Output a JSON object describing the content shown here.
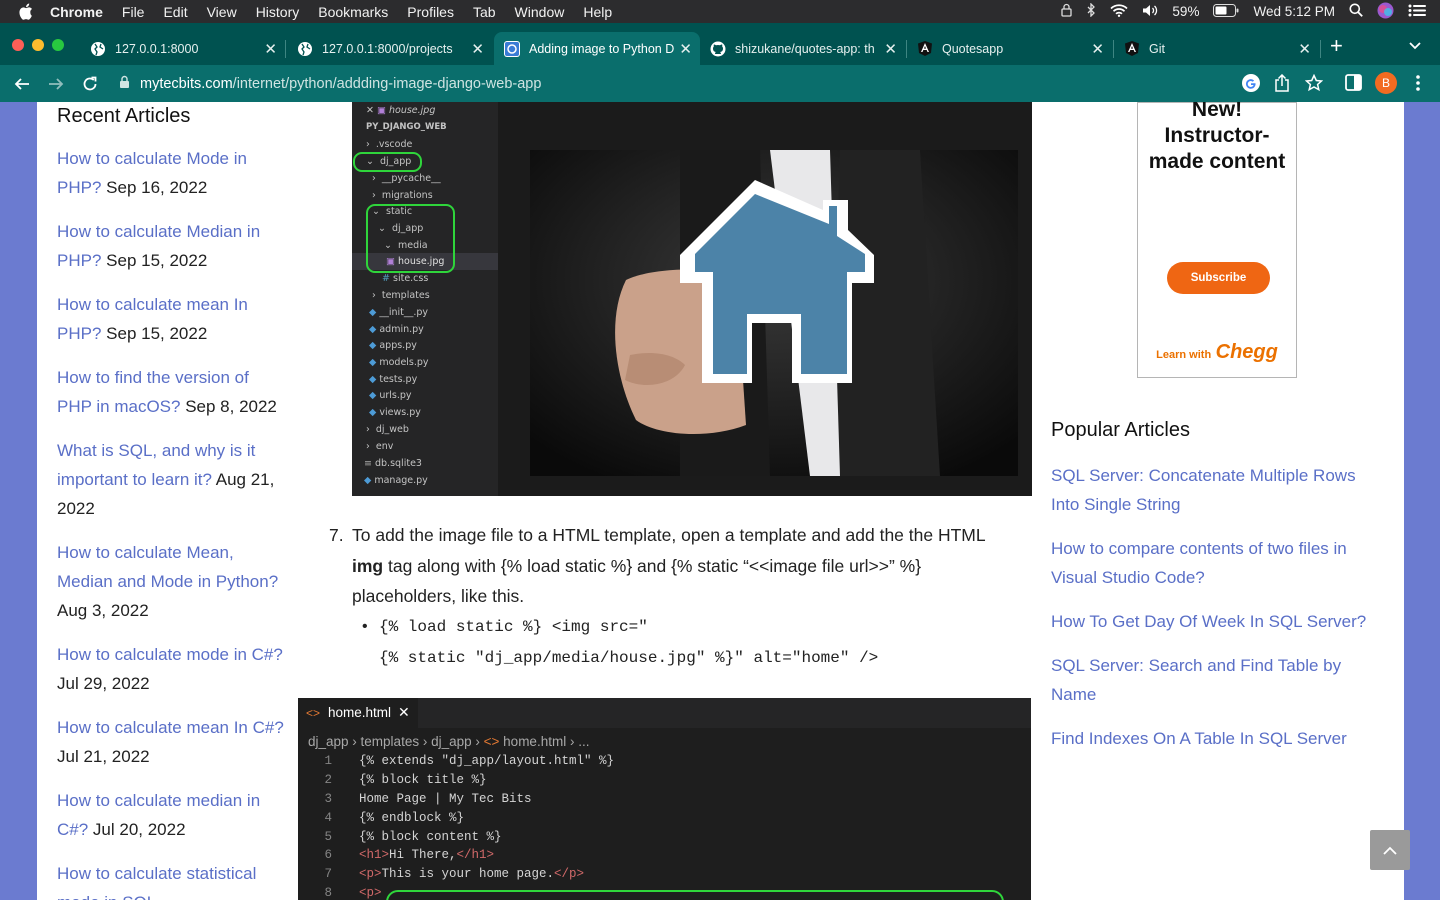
{
  "menubar": {
    "app": "Chrome",
    "items": [
      "File",
      "Edit",
      "View",
      "History",
      "Bookmarks",
      "Profiles",
      "Tab",
      "Window",
      "Help"
    ],
    "battery": "59%",
    "clock": "Wed 5:12 PM"
  },
  "tabs": [
    {
      "title": "127.0.0.1:8000"
    },
    {
      "title": "127.0.0.1:8000/projects"
    },
    {
      "title": "Adding image to Python D"
    },
    {
      "title": "shizukane/quotes-app: th"
    },
    {
      "title": "Quotesapp"
    },
    {
      "title": "Git"
    }
  ],
  "address": {
    "domain": "mytecbits.com",
    "path": "/internet/python/addding-image-django-web-app"
  },
  "profile_initial": "B",
  "recent": {
    "title": "Recent Articles",
    "items": [
      {
        "link": "How to calculate Mode in PHP?",
        "date": " Sep 16, 2022"
      },
      {
        "link": "How to calculate Median in PHP?",
        "date": " Sep 15, 2022"
      },
      {
        "link": "How to calculate mean In PHP?",
        "date": " Sep 15, 2022"
      },
      {
        "link": "How to find the version of PHP in macOS?",
        "date": " Sep 8, 2022"
      },
      {
        "link": "What is SQL, and why is it important to learn it?",
        "date": " Aug 21, 2022"
      },
      {
        "link": "How to calculate Mean, Median and Mode in Python?",
        "date": " Aug 3, 2022"
      },
      {
        "link": "How to calculate mode in C#?",
        "date": " Jul 29, 2022"
      },
      {
        "link": "How to calculate mean In C#?",
        "date": " Jul 21, 2022"
      },
      {
        "link": "How to calculate median in C#?",
        "date": " Jul 20, 2022"
      },
      {
        "link": "How to calculate statistical mode in SQL",
        "date": ""
      }
    ]
  },
  "explorer": {
    "open_file": "house.jpg",
    "project": "PY_DJANGO_WEB",
    "entries": [
      ".vscode",
      "dj_app",
      "__pycache__",
      "migrations",
      "static",
      "dj_app",
      "media",
      "house.jpg",
      "site.css",
      "templates",
      "__init__.py",
      "admin.py",
      "apps.py",
      "models.py",
      "tests.py",
      "urls.py",
      "views.py",
      "dj_web",
      "env",
      "db.sqlite3",
      "manage.py"
    ]
  },
  "step7": {
    "num": "7.",
    "t1": "To add the image file to a HTML template, open a template and add the the HTML ",
    "bold": "img",
    "t2": " tag along with {% load static %} and {% static “<<image file url>>” %} placeholders, like this."
  },
  "bullet": {
    "line1": "{% load static %} <img src=\"",
    "line2": "{% static \"dj_app/media/house.jpg\" %}\" alt=\"home\" />"
  },
  "editor": {
    "tab": "home.html",
    "crumbs": [
      "dj_app",
      "templates",
      "dj_app",
      "home.html",
      "..."
    ],
    "lines": [
      {
        "n": "1",
        "t": "{% extends \"dj_app/layout.html\" %}"
      },
      {
        "n": "2",
        "t": "{% block title %}"
      },
      {
        "n": "3",
        "t": "Home Page | My Tec Bits"
      },
      {
        "n": "4",
        "t": "{% endblock %}"
      },
      {
        "n": "5",
        "t": "{% block content %}"
      },
      {
        "n": "6",
        "t": "<h1>Hi There,</h1>"
      },
      {
        "n": "7",
        "t": "<p>This is your home page.</p>"
      },
      {
        "n": "8",
        "t": "<p>"
      }
    ]
  },
  "ad": {
    "headline": "New! Instructor-made content",
    "button": "Subscribe",
    "foot_small": "Learn with",
    "foot_brand": "Chegg"
  },
  "popular": {
    "title": "Popular Articles",
    "items": [
      "SQL Server: Concatenate Multiple Rows Into Single String",
      "How to compare contents of two files in Visual Studio Code?",
      "How To Get Day Of Week In SQL Server?",
      "SQL Server: Search and Find Table by Name",
      "Find Indexes On A Table In SQL Server"
    ]
  },
  "colors": {
    "link": "#5a6fc7",
    "tab_strip": "#005250",
    "toolbar": "#0a6e6c",
    "side_bg": "#6b7bd0",
    "highlight": "#2fd53b"
  }
}
